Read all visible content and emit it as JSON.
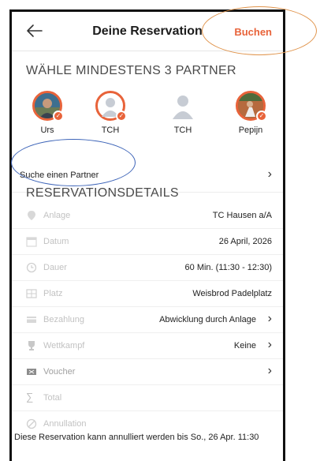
{
  "header": {
    "title": "Deine Reservation",
    "action_label": "Buchen"
  },
  "partners_section": {
    "heading": "WÄHLE MINDESTENS 3 PARTNER",
    "partners": [
      {
        "name": "Urs",
        "selected": true,
        "photo": "photo"
      },
      {
        "name": "TCH",
        "selected": true,
        "photo": "placeholder"
      },
      {
        "name": "TCH",
        "selected": false,
        "photo": "placeholder"
      },
      {
        "name": "Pepijn",
        "selected": true,
        "photo": "photo"
      }
    ],
    "search_label": "Suche einen Partner"
  },
  "details_section": {
    "heading": "RESERVATIONSDETAILS",
    "rows": [
      {
        "icon": "location-pin-icon",
        "label": "Anlage",
        "value": "TC Hausen a/A",
        "has_chevron": false
      },
      {
        "icon": "calendar-icon",
        "label": "Datum",
        "value": "26 April, 2026",
        "has_chevron": false
      },
      {
        "icon": "clock-icon",
        "label": "Dauer",
        "value": "60 Min. (11:30 - 12:30)",
        "has_chevron": false
      },
      {
        "icon": "court-icon",
        "label": "Platz",
        "value": "Weisbrod Padelplatz",
        "has_chevron": false
      },
      {
        "icon": "card-icon",
        "label": "Bezahlung",
        "value": "Abwicklung durch Anlage",
        "has_chevron": true
      },
      {
        "icon": "trophy-icon",
        "label": "Wettkampf",
        "value": "Keine",
        "has_chevron": true
      },
      {
        "icon": "voucher-icon",
        "label": "Voucher",
        "value": "",
        "has_chevron": true
      },
      {
        "icon": "sum-icon",
        "label": "Total",
        "value": "",
        "has_chevron": false
      },
      {
        "icon": "cancel-icon",
        "label": "Annullation",
        "value": "",
        "has_chevron": false
      }
    ],
    "cancellation_note": "Diese Reservation kann annulliert werden bis So., 26 Apr. 11:30"
  },
  "colors": {
    "accent": "#e8633a",
    "annotation_orange": "#e0944c",
    "annotation_blue": "#3d64b8"
  }
}
